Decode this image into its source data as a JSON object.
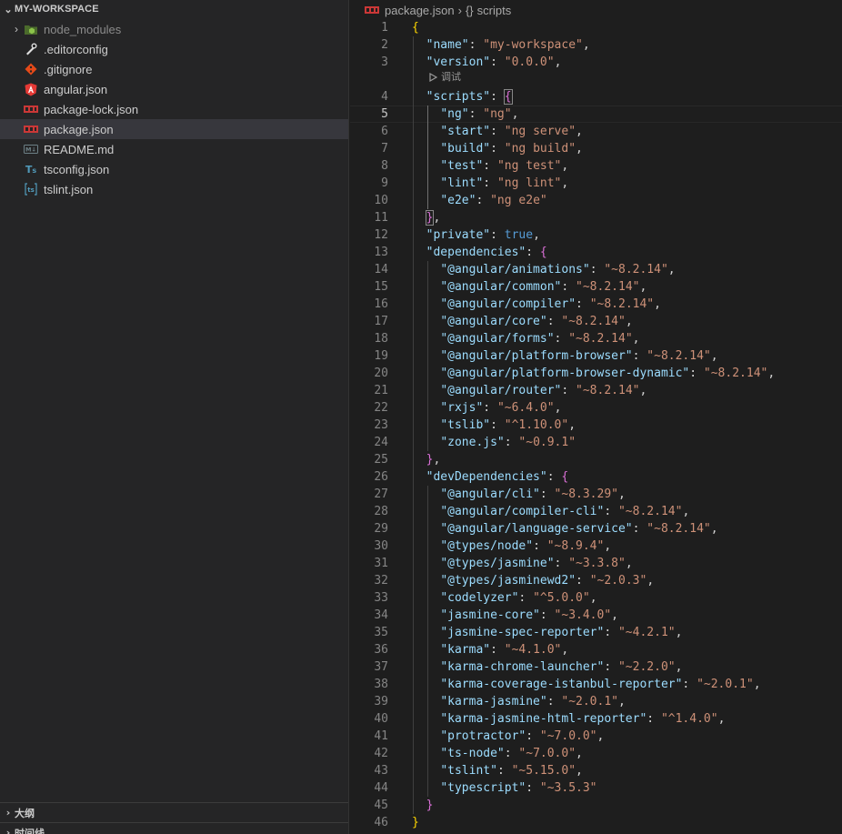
{
  "explorer": {
    "title": "MY-WORKSPACE",
    "items": [
      {
        "label": "node_modules",
        "icon": "node-folder-icon",
        "type": "folder",
        "color": "#8bc34a"
      },
      {
        "label": ".editorconfig",
        "icon": "editorconfig-icon",
        "type": "file",
        "color": "#e0e0e0"
      },
      {
        "label": ".gitignore",
        "icon": "git-icon",
        "type": "file",
        "color": "#e64a19"
      },
      {
        "label": "angular.json",
        "icon": "angular-icon",
        "type": "file",
        "color": "#e53935"
      },
      {
        "label": "package-lock.json",
        "icon": "npm-icon",
        "type": "file",
        "color": "#cb3837"
      },
      {
        "label": "package.json",
        "icon": "npm-icon",
        "type": "file",
        "color": "#cb3837",
        "selected": true
      },
      {
        "label": "README.md",
        "icon": "markdown-icon",
        "type": "file",
        "color": "#6d8086"
      },
      {
        "label": "tsconfig.json",
        "icon": "tsconfig-icon",
        "type": "file",
        "color": "#519aba"
      },
      {
        "label": "tslint.json",
        "icon": "tslint-icon",
        "type": "file",
        "color": "#519aba"
      }
    ]
  },
  "panels": {
    "outline": "大纲",
    "timeline": "时间线"
  },
  "breadcrumb": {
    "file": "package.json",
    "symbol_brace": "{}",
    "symbol": "scripts"
  },
  "codelens": {
    "label": "调试"
  },
  "editor": {
    "current_line": 5,
    "lines": [
      [
        [
          "b1",
          "{"
        ]
      ],
      [
        [
          "p",
          "  "
        ],
        [
          "k",
          "\"name\""
        ],
        [
          "p",
          ": "
        ],
        [
          "s",
          "\"my-workspace\""
        ],
        [
          "p",
          ","
        ]
      ],
      [
        [
          "p",
          "  "
        ],
        [
          "k",
          "\"version\""
        ],
        [
          "p",
          ": "
        ],
        [
          "s",
          "\"0.0.0\""
        ],
        [
          "p",
          ","
        ]
      ],
      [
        [
          "p",
          "  "
        ],
        [
          "k",
          "\"scripts\""
        ],
        [
          "p",
          ": "
        ],
        [
          "b2box",
          "{"
        ]
      ],
      [
        [
          "p",
          "    "
        ],
        [
          "k",
          "\"ng\""
        ],
        [
          "p",
          ": "
        ],
        [
          "s",
          "\"ng\""
        ],
        [
          "p",
          ","
        ]
      ],
      [
        [
          "p",
          "    "
        ],
        [
          "k",
          "\"start\""
        ],
        [
          "p",
          ": "
        ],
        [
          "s",
          "\"ng serve\""
        ],
        [
          "p",
          ","
        ]
      ],
      [
        [
          "p",
          "    "
        ],
        [
          "k",
          "\"build\""
        ],
        [
          "p",
          ": "
        ],
        [
          "s",
          "\"ng build\""
        ],
        [
          "p",
          ","
        ]
      ],
      [
        [
          "p",
          "    "
        ],
        [
          "k",
          "\"test\""
        ],
        [
          "p",
          ": "
        ],
        [
          "s",
          "\"ng test\""
        ],
        [
          "p",
          ","
        ]
      ],
      [
        [
          "p",
          "    "
        ],
        [
          "k",
          "\"lint\""
        ],
        [
          "p",
          ": "
        ],
        [
          "s",
          "\"ng lint\""
        ],
        [
          "p",
          ","
        ]
      ],
      [
        [
          "p",
          "    "
        ],
        [
          "k",
          "\"e2e\""
        ],
        [
          "p",
          ": "
        ],
        [
          "s",
          "\"ng e2e\""
        ]
      ],
      [
        [
          "p",
          "  "
        ],
        [
          "b2box",
          "}"
        ],
        [
          "p",
          ","
        ]
      ],
      [
        [
          "p",
          "  "
        ],
        [
          "k",
          "\"private\""
        ],
        [
          "p",
          ": "
        ],
        [
          "bool",
          "true"
        ],
        [
          "p",
          ","
        ]
      ],
      [
        [
          "p",
          "  "
        ],
        [
          "k",
          "\"dependencies\""
        ],
        [
          "p",
          ": "
        ],
        [
          "b2",
          "{"
        ]
      ],
      [
        [
          "p",
          "    "
        ],
        [
          "k",
          "\"@angular/animations\""
        ],
        [
          "p",
          ": "
        ],
        [
          "s",
          "\"~8.2.14\""
        ],
        [
          "p",
          ","
        ]
      ],
      [
        [
          "p",
          "    "
        ],
        [
          "k",
          "\"@angular/common\""
        ],
        [
          "p",
          ": "
        ],
        [
          "s",
          "\"~8.2.14\""
        ],
        [
          "p",
          ","
        ]
      ],
      [
        [
          "p",
          "    "
        ],
        [
          "k",
          "\"@angular/compiler\""
        ],
        [
          "p",
          ": "
        ],
        [
          "s",
          "\"~8.2.14\""
        ],
        [
          "p",
          ","
        ]
      ],
      [
        [
          "p",
          "    "
        ],
        [
          "k",
          "\"@angular/core\""
        ],
        [
          "p",
          ": "
        ],
        [
          "s",
          "\"~8.2.14\""
        ],
        [
          "p",
          ","
        ]
      ],
      [
        [
          "p",
          "    "
        ],
        [
          "k",
          "\"@angular/forms\""
        ],
        [
          "p",
          ": "
        ],
        [
          "s",
          "\"~8.2.14\""
        ],
        [
          "p",
          ","
        ]
      ],
      [
        [
          "p",
          "    "
        ],
        [
          "k",
          "\"@angular/platform-browser\""
        ],
        [
          "p",
          ": "
        ],
        [
          "s",
          "\"~8.2.14\""
        ],
        [
          "p",
          ","
        ]
      ],
      [
        [
          "p",
          "    "
        ],
        [
          "k",
          "\"@angular/platform-browser-dynamic\""
        ],
        [
          "p",
          ": "
        ],
        [
          "s",
          "\"~8.2.14\""
        ],
        [
          "p",
          ","
        ]
      ],
      [
        [
          "p",
          "    "
        ],
        [
          "k",
          "\"@angular/router\""
        ],
        [
          "p",
          ": "
        ],
        [
          "s",
          "\"~8.2.14\""
        ],
        [
          "p",
          ","
        ]
      ],
      [
        [
          "p",
          "    "
        ],
        [
          "k",
          "\"rxjs\""
        ],
        [
          "p",
          ": "
        ],
        [
          "s",
          "\"~6.4.0\""
        ],
        [
          "p",
          ","
        ]
      ],
      [
        [
          "p",
          "    "
        ],
        [
          "k",
          "\"tslib\""
        ],
        [
          "p",
          ": "
        ],
        [
          "s",
          "\"^1.10.0\""
        ],
        [
          "p",
          ","
        ]
      ],
      [
        [
          "p",
          "    "
        ],
        [
          "k",
          "\"zone.js\""
        ],
        [
          "p",
          ": "
        ],
        [
          "s",
          "\"~0.9.1\""
        ]
      ],
      [
        [
          "p",
          "  "
        ],
        [
          "b2",
          "}"
        ],
        [
          "p",
          ","
        ]
      ],
      [
        [
          "p",
          "  "
        ],
        [
          "k",
          "\"devDependencies\""
        ],
        [
          "p",
          ": "
        ],
        [
          "b2",
          "{"
        ]
      ],
      [
        [
          "p",
          "    "
        ],
        [
          "k",
          "\"@angular/cli\""
        ],
        [
          "p",
          ": "
        ],
        [
          "s",
          "\"~8.3.29\""
        ],
        [
          "p",
          ","
        ]
      ],
      [
        [
          "p",
          "    "
        ],
        [
          "k",
          "\"@angular/compiler-cli\""
        ],
        [
          "p",
          ": "
        ],
        [
          "s",
          "\"~8.2.14\""
        ],
        [
          "p",
          ","
        ]
      ],
      [
        [
          "p",
          "    "
        ],
        [
          "k",
          "\"@angular/language-service\""
        ],
        [
          "p",
          ": "
        ],
        [
          "s",
          "\"~8.2.14\""
        ],
        [
          "p",
          ","
        ]
      ],
      [
        [
          "p",
          "    "
        ],
        [
          "k",
          "\"@types/node\""
        ],
        [
          "p",
          ": "
        ],
        [
          "s",
          "\"~8.9.4\""
        ],
        [
          "p",
          ","
        ]
      ],
      [
        [
          "p",
          "    "
        ],
        [
          "k",
          "\"@types/jasmine\""
        ],
        [
          "p",
          ": "
        ],
        [
          "s",
          "\"~3.3.8\""
        ],
        [
          "p",
          ","
        ]
      ],
      [
        [
          "p",
          "    "
        ],
        [
          "k",
          "\"@types/jasminewd2\""
        ],
        [
          "p",
          ": "
        ],
        [
          "s",
          "\"~2.0.3\""
        ],
        [
          "p",
          ","
        ]
      ],
      [
        [
          "p",
          "    "
        ],
        [
          "k",
          "\"codelyzer\""
        ],
        [
          "p",
          ": "
        ],
        [
          "s",
          "\"^5.0.0\""
        ],
        [
          "p",
          ","
        ]
      ],
      [
        [
          "p",
          "    "
        ],
        [
          "k",
          "\"jasmine-core\""
        ],
        [
          "p",
          ": "
        ],
        [
          "s",
          "\"~3.4.0\""
        ],
        [
          "p",
          ","
        ]
      ],
      [
        [
          "p",
          "    "
        ],
        [
          "k",
          "\"jasmine-spec-reporter\""
        ],
        [
          "p",
          ": "
        ],
        [
          "s",
          "\"~4.2.1\""
        ],
        [
          "p",
          ","
        ]
      ],
      [
        [
          "p",
          "    "
        ],
        [
          "k",
          "\"karma\""
        ],
        [
          "p",
          ": "
        ],
        [
          "s",
          "\"~4.1.0\""
        ],
        [
          "p",
          ","
        ]
      ],
      [
        [
          "p",
          "    "
        ],
        [
          "k",
          "\"karma-chrome-launcher\""
        ],
        [
          "p",
          ": "
        ],
        [
          "s",
          "\"~2.2.0\""
        ],
        [
          "p",
          ","
        ]
      ],
      [
        [
          "p",
          "    "
        ],
        [
          "k",
          "\"karma-coverage-istanbul-reporter\""
        ],
        [
          "p",
          ": "
        ],
        [
          "s",
          "\"~2.0.1\""
        ],
        [
          "p",
          ","
        ]
      ],
      [
        [
          "p",
          "    "
        ],
        [
          "k",
          "\"karma-jasmine\""
        ],
        [
          "p",
          ": "
        ],
        [
          "s",
          "\"~2.0.1\""
        ],
        [
          "p",
          ","
        ]
      ],
      [
        [
          "p",
          "    "
        ],
        [
          "k",
          "\"karma-jasmine-html-reporter\""
        ],
        [
          "p",
          ": "
        ],
        [
          "s",
          "\"^1.4.0\""
        ],
        [
          "p",
          ","
        ]
      ],
      [
        [
          "p",
          "    "
        ],
        [
          "k",
          "\"protractor\""
        ],
        [
          "p",
          ": "
        ],
        [
          "s",
          "\"~7.0.0\""
        ],
        [
          "p",
          ","
        ]
      ],
      [
        [
          "p",
          "    "
        ],
        [
          "k",
          "\"ts-node\""
        ],
        [
          "p",
          ": "
        ],
        [
          "s",
          "\"~7.0.0\""
        ],
        [
          "p",
          ","
        ]
      ],
      [
        [
          "p",
          "    "
        ],
        [
          "k",
          "\"tslint\""
        ],
        [
          "p",
          ": "
        ],
        [
          "s",
          "\"~5.15.0\""
        ],
        [
          "p",
          ","
        ]
      ],
      [
        [
          "p",
          "    "
        ],
        [
          "k",
          "\"typescript\""
        ],
        [
          "p",
          ": "
        ],
        [
          "s",
          "\"~3.5.3\""
        ]
      ],
      [
        [
          "p",
          "  "
        ],
        [
          "b2",
          "}"
        ]
      ],
      [
        [
          "b1",
          "}"
        ]
      ],
      []
    ]
  }
}
